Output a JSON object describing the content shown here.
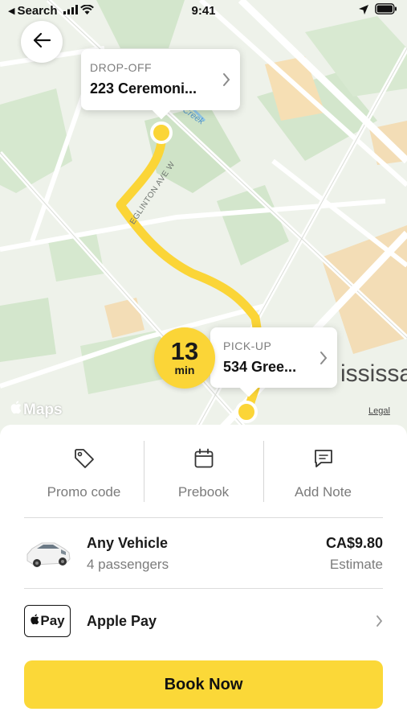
{
  "status_bar": {
    "back_app": "Search",
    "time": "9:41"
  },
  "map": {
    "road_label": "EGLINTON AVE W",
    "creek_label": "Creek",
    "city_fragment": "ississau",
    "maps_brand": "Maps",
    "legal": "Legal",
    "route_color": "#fbd537"
  },
  "dropoff": {
    "label": "DROP-OFF",
    "address": "223 Ceremoni..."
  },
  "pickup": {
    "label": "PICK-UP",
    "address": "534 Gree..."
  },
  "eta": {
    "value": "13",
    "unit": "min"
  },
  "actions": [
    {
      "label": "Promo code",
      "icon": "tag-icon"
    },
    {
      "label": "Prebook",
      "icon": "calendar-icon"
    },
    {
      "label": "Add Note",
      "icon": "message-icon"
    }
  ],
  "vehicle": {
    "name": "Any Vehicle",
    "passengers": "4 passengers",
    "price": "CA$9.80",
    "price_note": "Estimate"
  },
  "payment": {
    "badge": "Pay",
    "method": "Apple Pay"
  },
  "book_button": "Book Now",
  "colors": {
    "accent": "#fbd838",
    "muted_text": "#7b7b7b"
  }
}
